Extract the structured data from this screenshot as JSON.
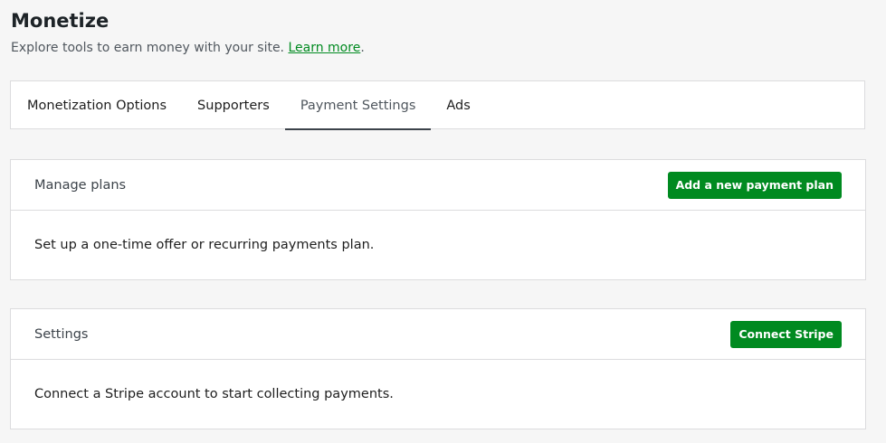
{
  "header": {
    "title": "Monetize",
    "subtitle": "Explore tools to earn money with your site.",
    "learn_more": "Learn more",
    "period": "."
  },
  "tabs": [
    {
      "label": "Monetization Options",
      "active": false
    },
    {
      "label": "Supporters",
      "active": false
    },
    {
      "label": "Payment Settings",
      "active": true
    },
    {
      "label": "Ads",
      "active": false
    }
  ],
  "plans": {
    "title": "Manage plans",
    "button": "Add a new payment plan",
    "body": "Set up a one-time offer or recurring payments plan."
  },
  "settings": {
    "title": "Settings",
    "button": "Connect Stripe",
    "body": "Connect a Stripe account to start collecting payments."
  },
  "colors": {
    "accent": "#008a20",
    "tab_indicator": "#3c434a"
  }
}
